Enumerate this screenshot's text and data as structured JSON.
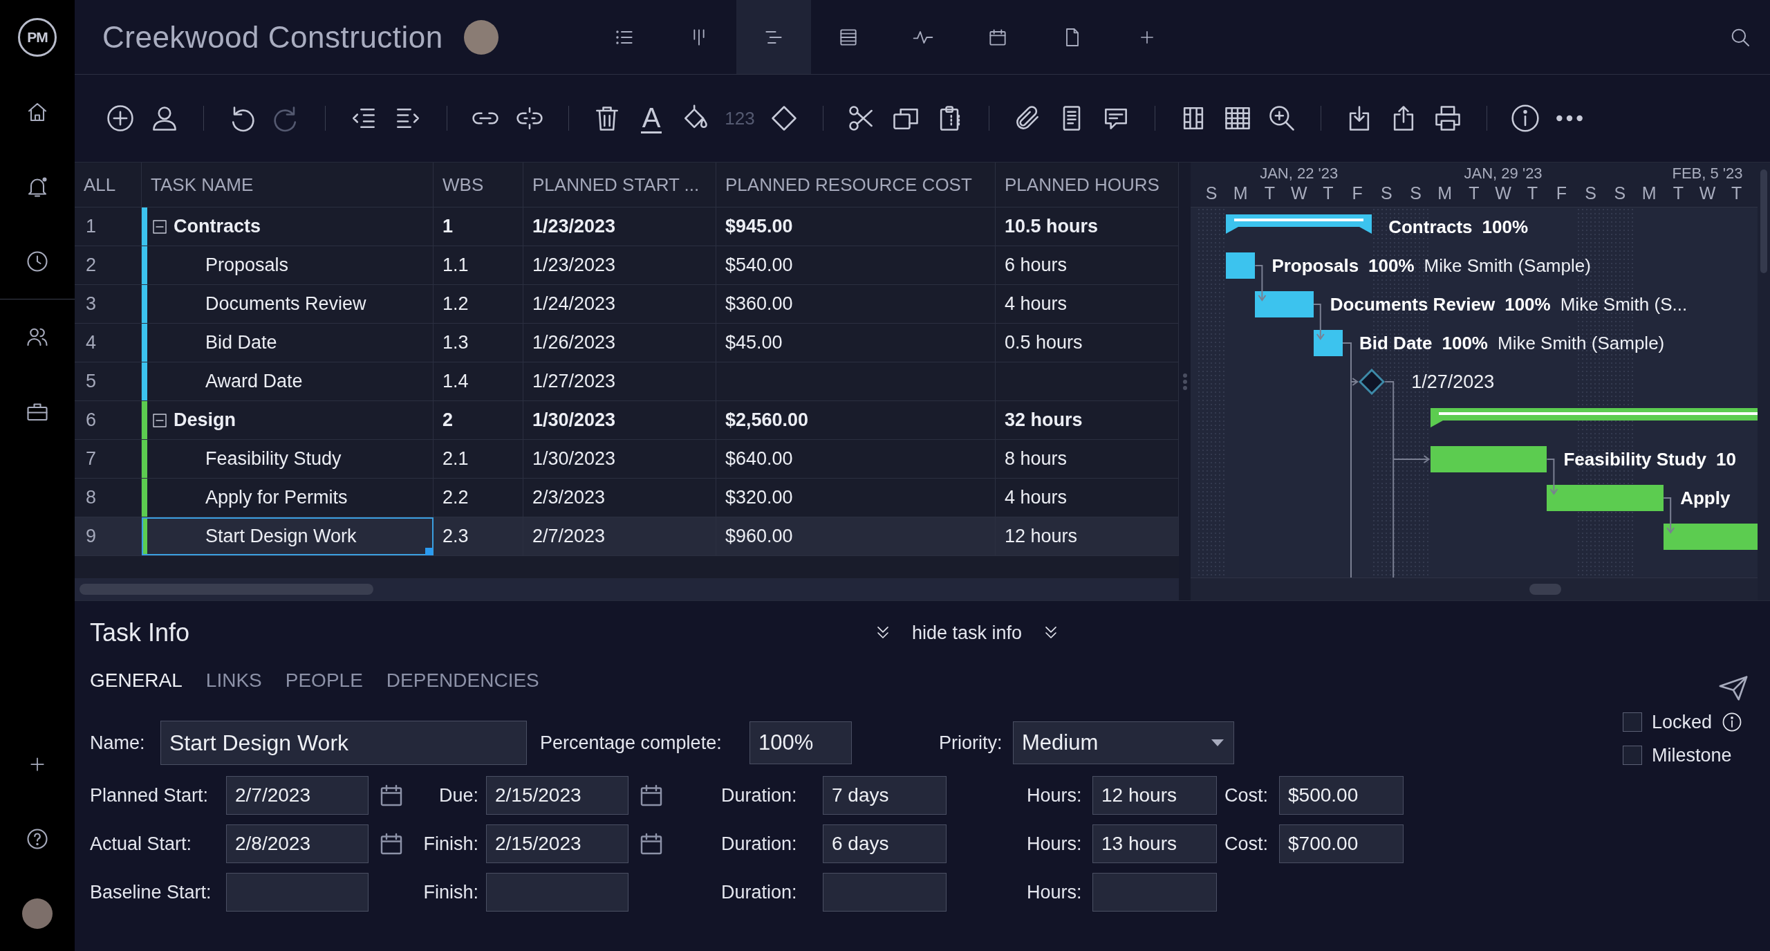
{
  "sidebar": {
    "logo": "PM"
  },
  "header": {
    "project_title": "Creekwood Construction",
    "view_tabs": [
      {
        "selected": false
      },
      {
        "selected": false
      },
      {
        "selected": true
      },
      {
        "selected": false
      },
      {
        "selected": false
      },
      {
        "selected": false
      },
      {
        "selected": false
      }
    ]
  },
  "toolbar": {
    "text_color_glyph": "A",
    "number_format_glyph": "123",
    "redo_disabled": true
  },
  "table": {
    "columns": [
      "ALL",
      "TASK NAME",
      "WBS",
      "PLANNED START ...",
      "PLANNED RESOURCE COST",
      "PLANNED HOURS"
    ],
    "rows": [
      {
        "number": "1",
        "name": "Contracts",
        "wbs": "1",
        "planned_start": "1/23/2023",
        "cost": "$945.00",
        "hours": "10.5 hours",
        "color": "#3cc3ee",
        "expanded": true,
        "selected": false,
        "children": [
          {
            "number": "2",
            "name": "Proposals",
            "wbs": "1.1",
            "planned_start": "1/23/2023",
            "cost": "$540.00",
            "hours": "6 hours",
            "selected": false
          },
          {
            "number": "3",
            "name": "Documents Review",
            "wbs": "1.2",
            "planned_start": "1/24/2023",
            "cost": "$360.00",
            "hours": "4 hours",
            "selected": false
          },
          {
            "number": "4",
            "name": "Bid Date",
            "wbs": "1.3",
            "planned_start": "1/26/2023",
            "cost": "$45.00",
            "hours": "0.5 hours",
            "selected": false
          },
          {
            "number": "5",
            "name": "Award Date",
            "wbs": "1.4",
            "planned_start": "1/27/2023",
            "selected": false
          }
        ]
      },
      {
        "number": "6",
        "name": "Design",
        "wbs": "2",
        "planned_start": "1/30/2023",
        "cost": "$2,560.00",
        "hours": "32 hours",
        "color": "#5ccc50",
        "expanded": true,
        "selected": false,
        "children": [
          {
            "number": "7",
            "name": "Feasibility Study",
            "wbs": "2.1",
            "planned_start": "1/30/2023",
            "cost": "$640.00",
            "hours": "8 hours",
            "selected": false
          },
          {
            "number": "8",
            "name": "Apply for Permits",
            "wbs": "2.2",
            "planned_start": "2/3/2023",
            "cost": "$320.00",
            "hours": "4 hours",
            "selected": false
          },
          {
            "number": "9",
            "name": "Start Design Work",
            "wbs": "2.3",
            "planned_start": "2/7/2023",
            "cost": "$960.00",
            "hours": "12 hours",
            "selected": true
          }
        ]
      }
    ]
  },
  "gantt": {
    "weeks": [
      "JAN, 22 '23",
      "JAN, 29 '23",
      "FEB, 5 '23"
    ],
    "days": [
      "S",
      "M",
      "T",
      "W",
      "T",
      "F",
      "S",
      "S",
      "M",
      "T",
      "W",
      "T",
      "F",
      "S",
      "S",
      "M",
      "T",
      "W",
      "T"
    ],
    "bars": [
      {
        "kind": "summary",
        "label": "Contracts",
        "percent": "100%",
        "color": "#3cc3ee",
        "linked": false
      },
      {
        "kind": "task",
        "label": "Proposals",
        "percent": "100%",
        "assignee": "Mike Smith (Sample)",
        "color": "#3cc3ee",
        "linked": false
      },
      {
        "kind": "task",
        "label": "Documents Review",
        "percent": "100%",
        "assignee": "Mike Smith (S...",
        "color": "#3cc3ee",
        "linked": true
      },
      {
        "kind": "task",
        "label": "Bid Date",
        "percent": "100%",
        "assignee": "Mike Smith (Sample)",
        "color": "#3cc3ee",
        "linked": true
      },
      {
        "kind": "milestone",
        "label": "1/27/2023",
        "linked": true
      },
      {
        "kind": "summary",
        "color": "#5ccc50",
        "linked": false
      },
      {
        "kind": "task",
        "label": "Feasibility Study",
        "percent": "10",
        "color": "#5ccc50",
        "linked": true
      },
      {
        "kind": "task",
        "label": "Apply",
        "color": "#5ccc50",
        "linked": true
      },
      {
        "kind": "task",
        "color": "#5ccc50",
        "linked": true
      }
    ]
  },
  "task_info": {
    "title": "Task Info",
    "toggle_label": "hide task info",
    "tabs": [
      {
        "label": "GENERAL",
        "selected": true
      },
      {
        "label": "LINKS",
        "selected": false
      },
      {
        "label": "PEOPLE",
        "selected": false
      },
      {
        "label": "DEPENDENCIES",
        "selected": false
      }
    ],
    "name_field": {
      "label": "Name:",
      "value": "Start Design Work"
    },
    "percent_field": {
      "label": "Percentage complete:",
      "value": "100%"
    },
    "priority_field": {
      "label": "Priority:",
      "value": "Medium"
    },
    "checkboxes": [
      {
        "label": "Locked",
        "checked": false,
        "info": true
      },
      {
        "label": "Milestone",
        "checked": false,
        "info": false
      }
    ],
    "rows": [
      [
        {
          "kind": "date",
          "label": "Planned Start:",
          "value": "2/7/2023"
        },
        {
          "kind": "date",
          "label": "Due:",
          "value": "2/15/2023"
        },
        {
          "kind": "text",
          "label": "Duration:",
          "value": "7 days"
        },
        {
          "kind": "text",
          "label": "Hours:",
          "value": "12 hours"
        },
        {
          "kind": "text",
          "label": "Cost:",
          "value": "$500.00"
        }
      ],
      [
        {
          "kind": "date",
          "label": "Actual Start:",
          "value": "2/8/2023"
        },
        {
          "kind": "date",
          "label": "Finish:",
          "value": "2/15/2023"
        },
        {
          "kind": "text",
          "label": "Duration:",
          "value": "6 days"
        },
        {
          "kind": "text",
          "label": "Hours:",
          "value": "13 hours"
        },
        {
          "kind": "text",
          "label": "Cost:",
          "value": "$700.00"
        }
      ],
      [
        {
          "kind": "text",
          "label": "Baseline Start:"
        },
        {
          "kind": "text",
          "label": "Finish:"
        },
        {
          "kind": "text",
          "label": "Duration:"
        },
        {
          "kind": "text",
          "label": "Hours:"
        }
      ]
    ]
  }
}
